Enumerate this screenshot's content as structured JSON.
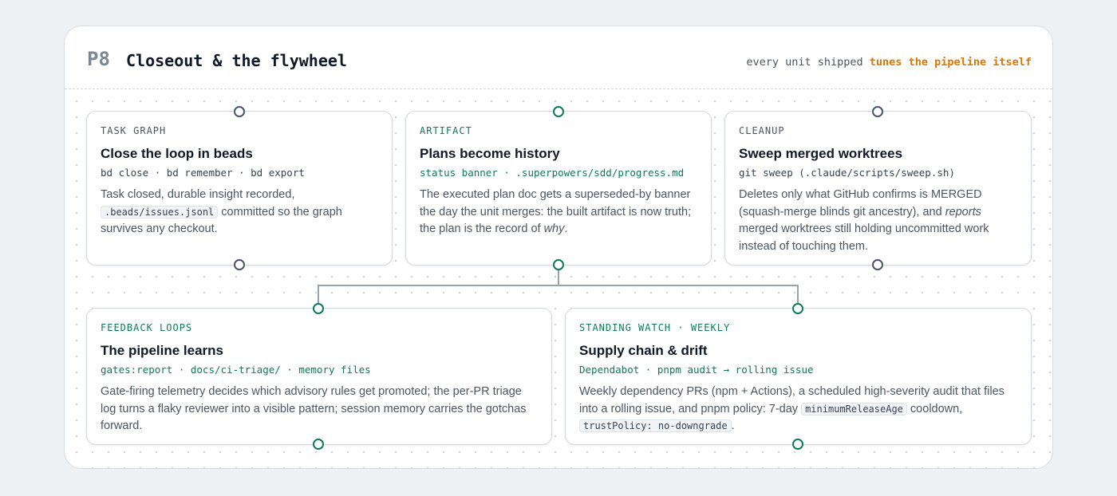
{
  "header": {
    "phase": "P8",
    "title": "Closeout & the flywheel",
    "tagline_plain": "every unit shipped ",
    "tagline_emphasis": "tunes the pipeline itself"
  },
  "cards": [
    {
      "eyebrow": "TASK GRAPH",
      "title": "Close the loop in beads",
      "command": "bd close · bd remember · bd export",
      "body_1": "Task closed, durable insight recorded, ",
      "body_code": ".beads/issues.jsonl",
      "body_2": " committed so the graph survives any checkout."
    },
    {
      "eyebrow": "ARTIFACT",
      "title": "Plans become history",
      "command": "status banner · .superpowers/sdd/progress.md",
      "body_1": "The executed plan doc gets a superseded-by banner the day the unit merges: the built artifact is now truth; the plan is the record of ",
      "body_em": "why",
      "body_2": "."
    },
    {
      "eyebrow": "CLEANUP",
      "title": "Sweep merged worktrees",
      "command": "git sweep (.claude/scripts/sweep.sh)",
      "body_1": "Deletes only what GitHub confirms is MERGED (squash-merge blinds git ancestry), and ",
      "body_em": "reports",
      "body_2": " merged worktrees still holding uncommitted work instead of touching them."
    },
    {
      "eyebrow": "FEEDBACK LOOPS",
      "title": "The pipeline learns",
      "command": "gates:report · docs/ci-triage/ · memory files",
      "body_1": "Gate-firing telemetry decides which advisory rules get promoted; the per-PR triage log turns a flaky reviewer into a visible pattern; session memory carries the gotchas forward."
    },
    {
      "eyebrow": "STANDING WATCH · WEEKLY",
      "title": "Supply chain & drift",
      "command": "Dependabot · pnpm audit → rolling issue",
      "body_1": "Weekly dependency PRs (npm + Actions), a scheduled high-severity audit that files into a rolling issue, and pnpm policy: 7-day ",
      "body_code": "minimumReleaseAge",
      "body_2": " cooldown, ",
      "body_code2": "trustPolicy: no-downgrade",
      "body_3": "."
    }
  ],
  "colors": {
    "accent_orange": "#d97706",
    "accent_green": "#0f7b54",
    "port_slate": "#4b5563",
    "connector": "#9aa3ad"
  }
}
